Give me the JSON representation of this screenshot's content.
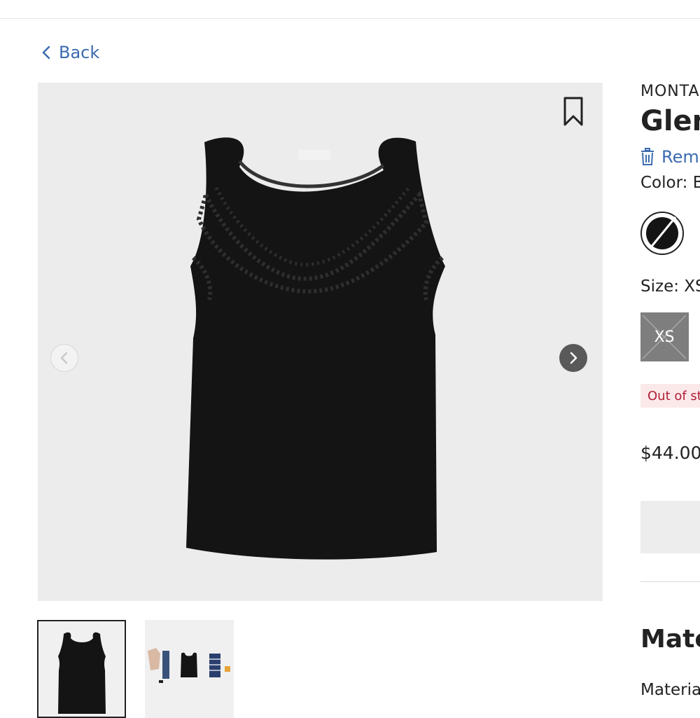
{
  "nav": {
    "back_label": "Back"
  },
  "product": {
    "brand": "MONTA",
    "title": "Glen",
    "remove_label": "Rem",
    "color_label": "Color:",
    "color_value": "B",
    "size_label": "Size:",
    "size_value": "XS",
    "size_options": [
      "XS"
    ],
    "stock_status": "Out of st",
    "price": "$44.00"
  },
  "gallery": {
    "thumbnail_count": 2,
    "selected_index": 0,
    "background_color": "#ececec"
  },
  "details": {
    "section_title": "Mate",
    "section_text": "Materia"
  },
  "colors": {
    "accent": "#3b6bb0",
    "out_of_stock_text": "#b01e35",
    "out_of_stock_bg": "#fbe9ea"
  }
}
